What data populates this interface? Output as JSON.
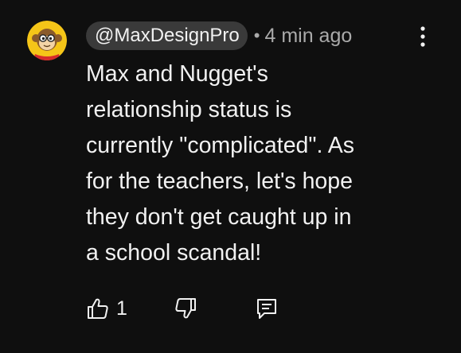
{
  "comment": {
    "author_handle": "@MaxDesignPro",
    "separator": "•",
    "timestamp": "4 min ago",
    "text_lines": [
      "Max and Nugget's",
      "relationship status is",
      "currently \"complicated\". As",
      "for the teachers, let's hope",
      "they don't get caught up in",
      "a school scandal!"
    ],
    "like_count": "1"
  },
  "icons": {
    "avatar": "avatar-cartoon-monkey",
    "menu": "more-vertical-icon",
    "like": "thumbs-up-icon",
    "dislike": "thumbs-down-icon",
    "reply": "reply-icon"
  },
  "colors": {
    "background": "#0f0f0f",
    "text": "#f1f1f1",
    "secondary_text": "#aaaaaa",
    "handle_pill": "#3a3a3a",
    "avatar_bg": "#f5c518"
  }
}
